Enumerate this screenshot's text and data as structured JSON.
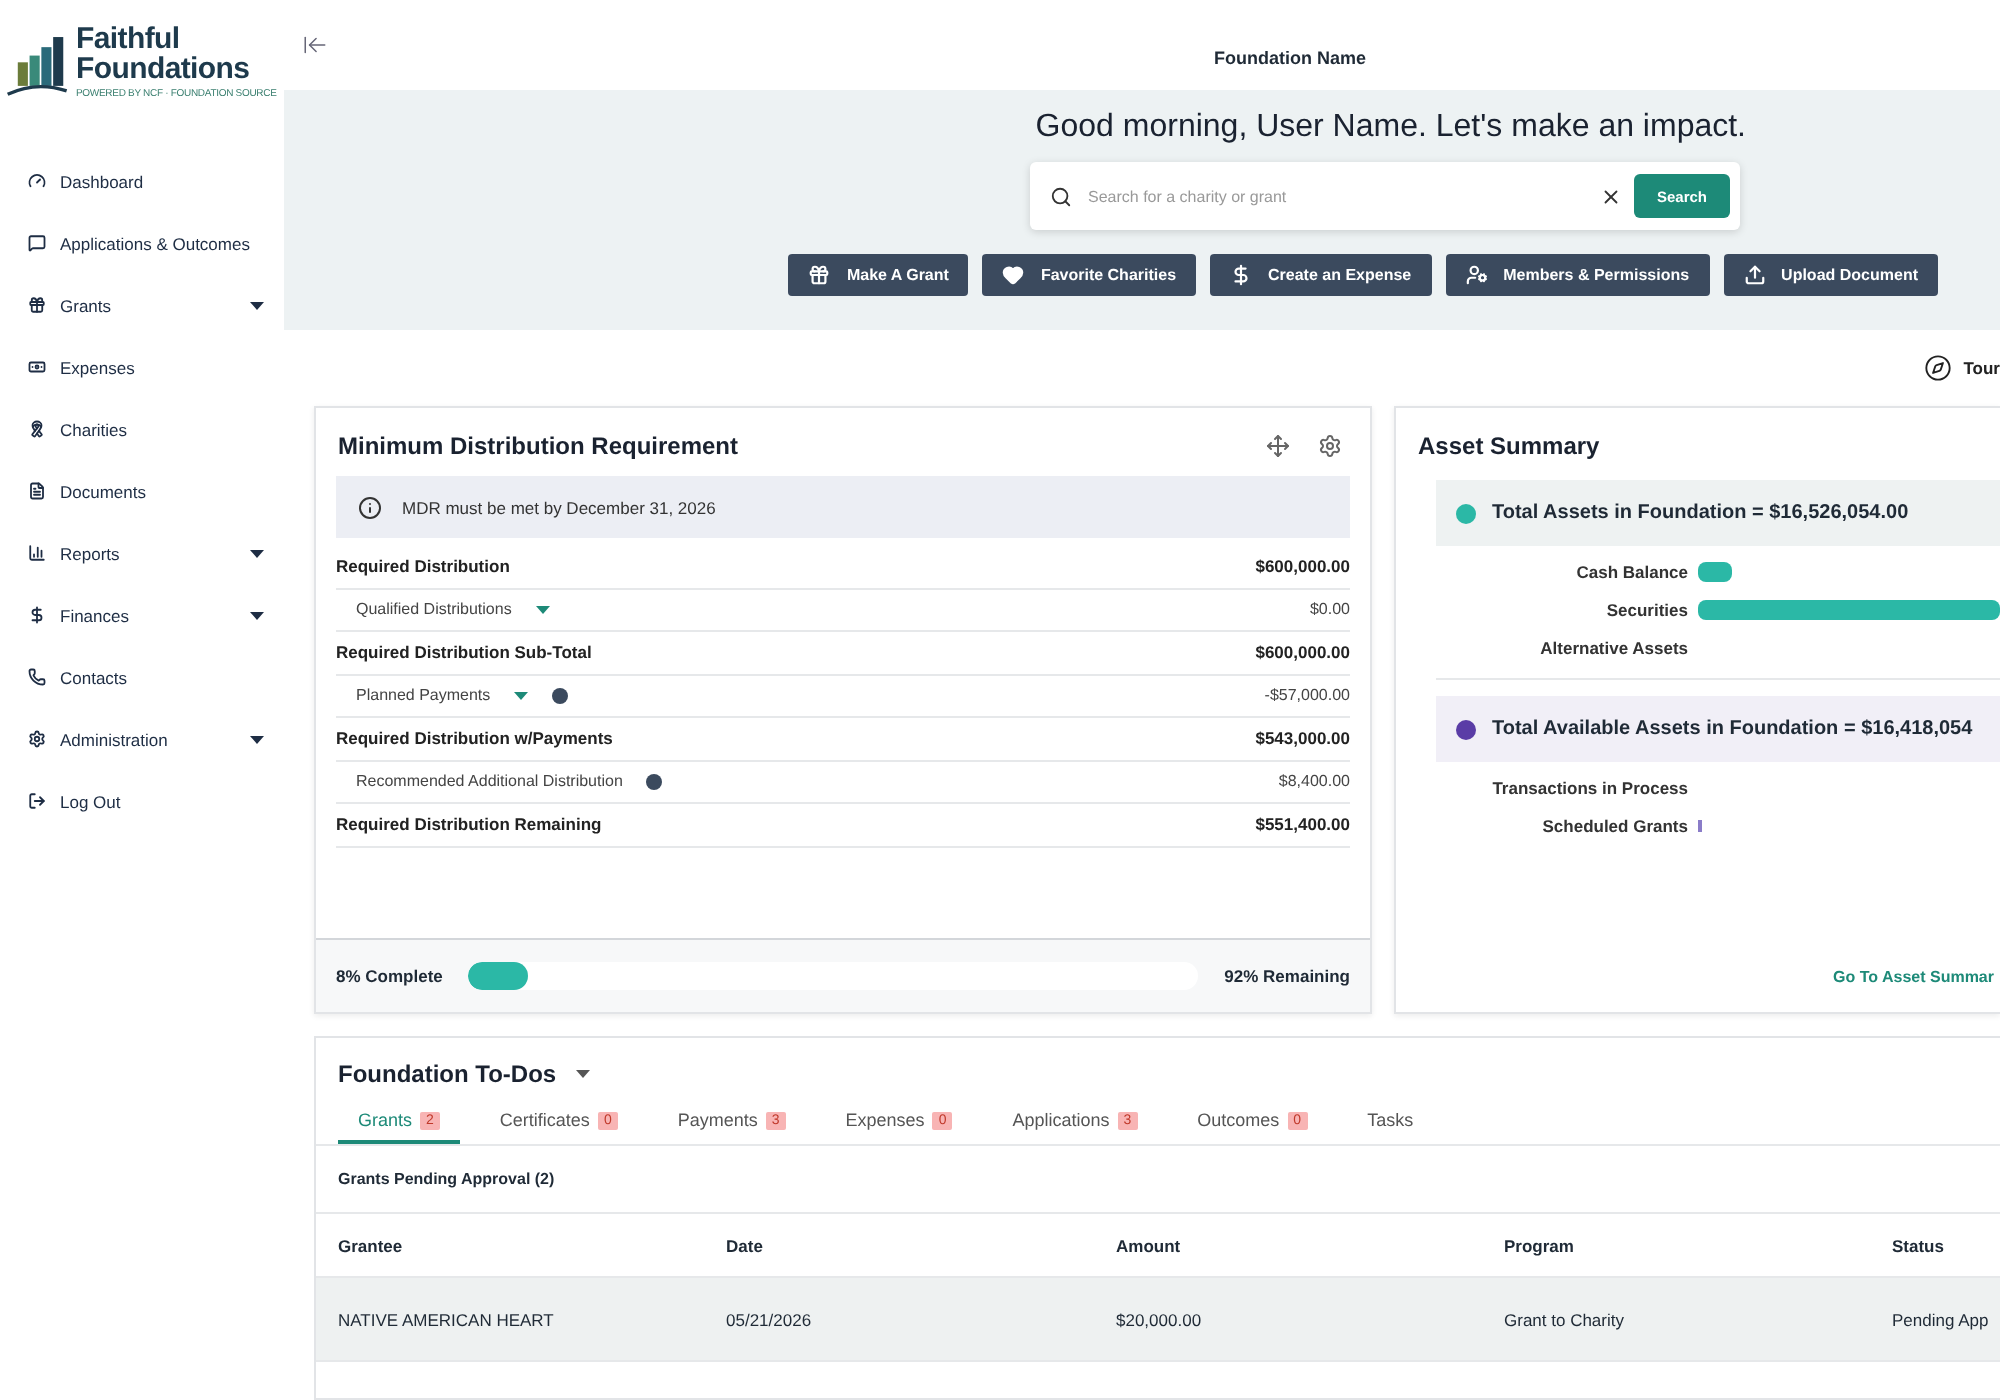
{
  "logo": {
    "name": "Faithful Foundations",
    "tagline": "POWERED BY NCF · FOUNDATION SOURCE"
  },
  "sidebar": {
    "items": [
      {
        "label": "Dashboard",
        "expandable": false
      },
      {
        "label": "Applications & Outcomes",
        "expandable": false
      },
      {
        "label": "Grants",
        "expandable": true
      },
      {
        "label": "Expenses",
        "expandable": false
      },
      {
        "label": "Charities",
        "expandable": false
      },
      {
        "label": "Documents",
        "expandable": false
      },
      {
        "label": "Reports",
        "expandable": true
      },
      {
        "label": "Finances",
        "expandable": true
      },
      {
        "label": "Contacts",
        "expandable": false
      },
      {
        "label": "Administration",
        "expandable": true
      },
      {
        "label": "Log Out",
        "expandable": false
      }
    ]
  },
  "header": {
    "title": "Foundation Name"
  },
  "hero": {
    "greeting": "Good morning, User Name. Let's make an impact.",
    "search": {
      "placeholder": "Search for a charity or grant",
      "button": "Search"
    },
    "actions": [
      "Make A Grant",
      "Favorite Charities",
      "Create an Expense",
      "Members & Permissions",
      "Upload Document"
    ]
  },
  "tour": {
    "label": "Tour"
  },
  "mdr": {
    "title": "Minimum Distribution Requirement",
    "notice": "MDR must be met by December 31, 2026",
    "rows": [
      {
        "kind": "total",
        "label": "Required Distribution",
        "value": "$600,000.00",
        "dropdown": false,
        "info": false
      },
      {
        "kind": "detail",
        "label": "Qualified Distributions",
        "value": "$0.00",
        "dropdown": true,
        "info": false
      },
      {
        "kind": "total",
        "label": "Required Distribution Sub-Total",
        "value": "$600,000.00",
        "dropdown": false,
        "info": false
      },
      {
        "kind": "detail",
        "label": "Planned Payments",
        "value": "-$57,000.00",
        "dropdown": true,
        "info": true
      },
      {
        "kind": "total",
        "label": "Required Distribution w/Payments",
        "value": "$543,000.00",
        "dropdown": false,
        "info": false
      },
      {
        "kind": "detail",
        "label": "Recommended Additional Distribution",
        "value": "$8,400.00",
        "dropdown": false,
        "info": true
      },
      {
        "kind": "total",
        "label": "Required Distribution Remaining",
        "value": "$551,400.00",
        "dropdown": false,
        "info": false
      }
    ],
    "progress": {
      "complete": "8% Complete",
      "remaining": "92% Remaining",
      "level": 0.08
    }
  },
  "assets": {
    "title": "Asset Summary",
    "link": "Go To Asset Summar",
    "groups": [
      {
        "title": "Total Assets in Foundation = $16,526,054.00",
        "color": "#2bb8a6",
        "items": [
          "Cash Balance",
          "Securities",
          "Alternative Assets"
        ]
      },
      {
        "title": "Total Available Assets in Foundation = $16,418,054",
        "color": "#5a3ca6",
        "items": [
          "Transactions in Process",
          "Scheduled Grants"
        ]
      }
    ]
  },
  "todos": {
    "title": "Foundation To-Dos",
    "tabs": [
      {
        "label": "Grants",
        "count": "2",
        "selected": true
      },
      {
        "label": "Certificates",
        "count": "0",
        "selected": false
      },
      {
        "label": "Payments",
        "count": "3",
        "selected": false
      },
      {
        "label": "Expenses",
        "count": "0",
        "selected": false
      },
      {
        "label": "Applications",
        "count": "3",
        "selected": false
      },
      {
        "label": "Outcomes",
        "count": "0",
        "selected": false
      },
      {
        "label": "Tasks",
        "selected": false
      }
    ],
    "section": "Grants Pending Approval (2)",
    "table": {
      "columns": [
        "Grantee",
        "Date",
        "Amount",
        "Program",
        "Status"
      ],
      "rows": [
        [
          "NATIVE AMERICAN HEART",
          "05/21/2026",
          "$20,000.00",
          "Grant to Charity",
          "Pending App"
        ]
      ]
    }
  }
}
